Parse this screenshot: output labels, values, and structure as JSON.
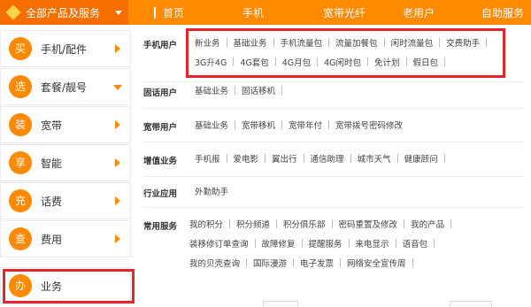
{
  "topbar": {
    "all_products": "全部产品及服务",
    "nav": [
      "首页",
      "手机",
      "宽带光纤",
      "老用户",
      "自助服务"
    ]
  },
  "sidebar": {
    "items": [
      {
        "icon_char": "买",
        "label": "手机/配件",
        "arrow": "right"
      },
      {
        "icon_char": "选",
        "label": "套餐/靓号",
        "arrow": "down"
      },
      {
        "icon_char": "装",
        "label": "宽带",
        "arrow": "right"
      },
      {
        "icon_char": "享",
        "label": "智能",
        "arrow": "right"
      },
      {
        "icon_char": "充",
        "label": "话费",
        "arrow": "right"
      },
      {
        "icon_char": "查",
        "label": "费用",
        "arrow": "right"
      },
      {
        "icon_char": "办",
        "label": "业务",
        "arrow": "none"
      }
    ]
  },
  "sections": [
    {
      "title": "手机用户",
      "lines": [
        [
          "新业务",
          "基础业务",
          "手机流量包",
          "流量加餐包",
          "闲时流量包",
          "交费助手"
        ],
        [
          "3G升4G",
          "4G套包",
          "4G月包",
          "4G闲时包",
          "免计划",
          "假日包"
        ]
      ]
    },
    {
      "title": "固话用户",
      "lines": [
        [
          "基础业务",
          "固话移机"
        ]
      ]
    },
    {
      "title": "宽带用户",
      "lines": [
        [
          "基础业务",
          "宽带移机",
          "宽带年付",
          "宽带拨号密码修改"
        ]
      ]
    },
    {
      "title": "增值业务",
      "lines": [
        [
          "手机报",
          "爱电影",
          "翼出行",
          "通信助理",
          "城市天气",
          "健康顾问"
        ]
      ]
    },
    {
      "title": "行业应用",
      "lines": [
        [
          "外勤助手"
        ]
      ]
    },
    {
      "title": "常用服务",
      "lines": [
        [
          "我的积分",
          "积分频道",
          "积分俱乐部",
          "密码重置及修改",
          "我的产品"
        ],
        [
          "装移修订单查询",
          "故障修复",
          "提醒服务",
          "来电显示",
          "语音包"
        ],
        [
          "我的贝壳查询",
          "国际漫游",
          "电子发票",
          "网络安全宣传周"
        ]
      ]
    }
  ],
  "colors": {
    "brand_orange": "#ff8a00",
    "dark_orange": "#f46f00",
    "highlight_red": "#e8242f"
  }
}
